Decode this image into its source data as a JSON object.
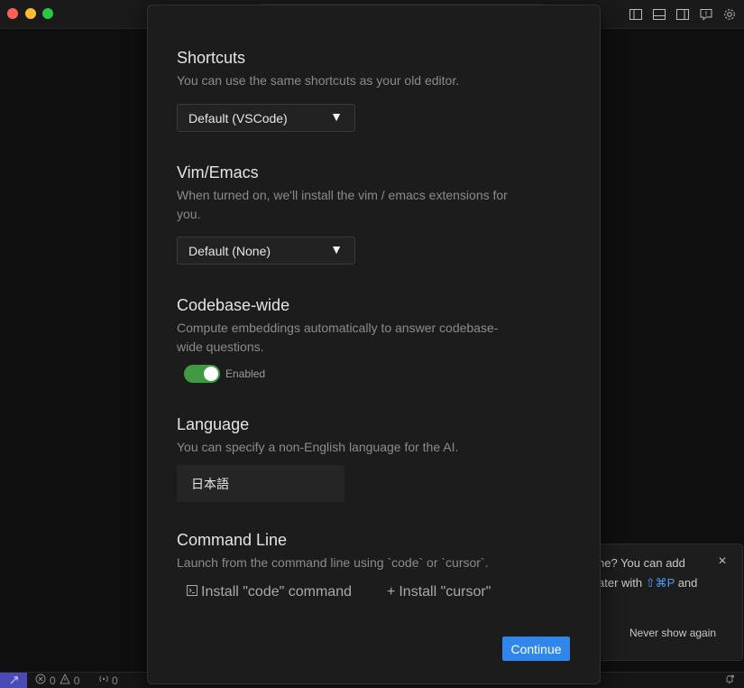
{
  "titlebar": {
    "layout_icons": [
      "sidebar-left-icon",
      "panel-bottom-icon",
      "sidebar-right-icon",
      "feedback-icon",
      "gear-icon"
    ]
  },
  "statusbar": {
    "errors": "0",
    "warnings": "0",
    "ports": "0"
  },
  "toast": {
    "line1": "ne? You can add",
    "line2_prefix": "ater with ",
    "line2_shortcut": "⇧⌘P",
    "line2_suffix": " and",
    "never_show": "Never show again"
  },
  "modal": {
    "shortcuts": {
      "title": "Shortcuts",
      "desc": "You can use the same shortcuts as your old editor.",
      "selected": "Default (VSCode)"
    },
    "vim": {
      "title": "Vim/Emacs",
      "desc": "When turned on, we'll install the vim / emacs extensions for you.",
      "selected": "Default (None)"
    },
    "codebase": {
      "title": "Codebase-wide",
      "desc": "Compute embeddings automatically to answer codebase-wide questions.",
      "toggle_label": "Enabled",
      "enabled": true
    },
    "language": {
      "title": "Language",
      "desc": "You can specify a non-English language for the AI.",
      "value": "日本語"
    },
    "command_line": {
      "title": "Command Line",
      "desc": "Launch from the command line using `code` or `cursor`.",
      "install_code": "Install \"code\" command",
      "install_cursor": "Install \"cursor\""
    },
    "continue_label": "Continue"
  },
  "colors": {
    "accent": "#2f86eb",
    "toggle_on": "#3f9a43",
    "remote": "#4a4ab8"
  }
}
